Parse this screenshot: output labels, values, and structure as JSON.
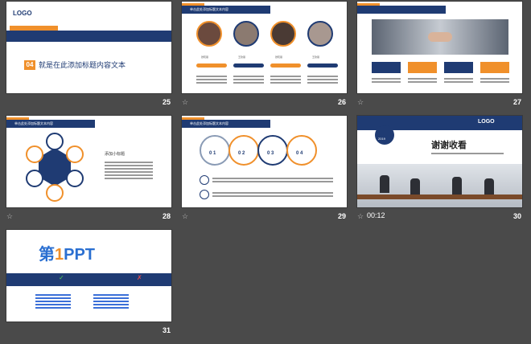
{
  "slides": {
    "s25": {
      "num": "25",
      "logo": "LOGO",
      "badge": "04",
      "title": "就是在此添加标题内容文本"
    },
    "s26": {
      "num": "26",
      "header": "单击此处添加标题文本内容",
      "names": [
        "张晓丽",
        "王钦丽",
        "张晓丽",
        "王钦丽"
      ]
    },
    "s27": {
      "num": "27"
    },
    "s28": {
      "num": "28",
      "header": "单击此处添加标题文本内容",
      "subtitle": "添加小标题"
    },
    "s29": {
      "num": "29",
      "header": "单击此处添加标题文本内容",
      "steps": [
        "0 1",
        "0 2",
        "0 3",
        "0 4"
      ]
    },
    "s30": {
      "num": "30",
      "time": "00:12",
      "logo": "LOGO",
      "year": "2019",
      "thanks": "谢谢收看"
    },
    "s31": {
      "num": "31",
      "brand_cn": "第",
      "brand_num": "1",
      "brand_en": "PPT"
    }
  },
  "colors": {
    "navy": "#1f3b73",
    "orange": "#f0902b",
    "bg": "#4a4a4a"
  }
}
